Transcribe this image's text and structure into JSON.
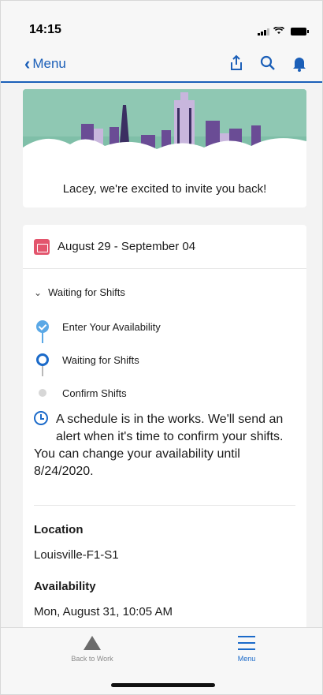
{
  "status_bar": {
    "time": "14:15"
  },
  "nav": {
    "back_label": "Menu",
    "actions": [
      "share-icon",
      "search-icon",
      "bell-icon"
    ],
    "accent": "#1b5fb8"
  },
  "hero": {
    "message": "Lacey, we're excited to invite you back!"
  },
  "schedule": {
    "date_range": "August 29 - September 04",
    "section_title": "Waiting for Shifts",
    "steps": [
      {
        "label": "Enter Your Availability",
        "state": "done"
      },
      {
        "label": "Waiting for Shifts",
        "state": "current"
      },
      {
        "label": "Confirm Shifts",
        "state": "pending"
      }
    ],
    "info_line1": "A schedule is in the works. We'll send an",
    "info_line2": "alert when it's time to confirm your shifts.",
    "info_line3": "You can change your availability until",
    "info_line4": "8/24/2020.",
    "location_label": "Location",
    "location_value": "Louisville-F1-S1",
    "availability_label": "Availability",
    "availability_value": "Mon, August 31, 10:05 AM"
  },
  "tab_bar": {
    "back_to_work": "Back to Work",
    "menu": "Menu"
  }
}
